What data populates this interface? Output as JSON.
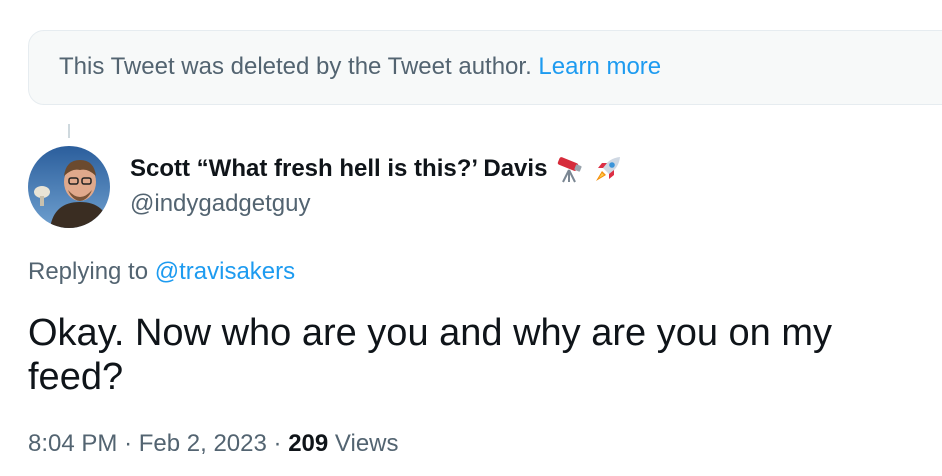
{
  "deleted_notice": {
    "text": "This Tweet was deleted by the Tweet author.",
    "link": "Learn more"
  },
  "author": {
    "display_name": "Scott “What fresh hell is this?’ Davis",
    "handle": "@indygadgetguy",
    "emoji": [
      "telescope-icon",
      "rocket-icon"
    ]
  },
  "reply": {
    "prefix": "Replying to",
    "mention": "@travisakers"
  },
  "tweet": {
    "text": "Okay. Now who are you and why are you on my feed?"
  },
  "meta": {
    "time": "8:04 PM",
    "separator": "·",
    "date": "Feb 2, 2023",
    "views_count": "209",
    "views_label": "Views"
  },
  "colors": {
    "link": "#1d9bf0",
    "secondary_text": "#536471",
    "primary_text": "#0f1419"
  }
}
